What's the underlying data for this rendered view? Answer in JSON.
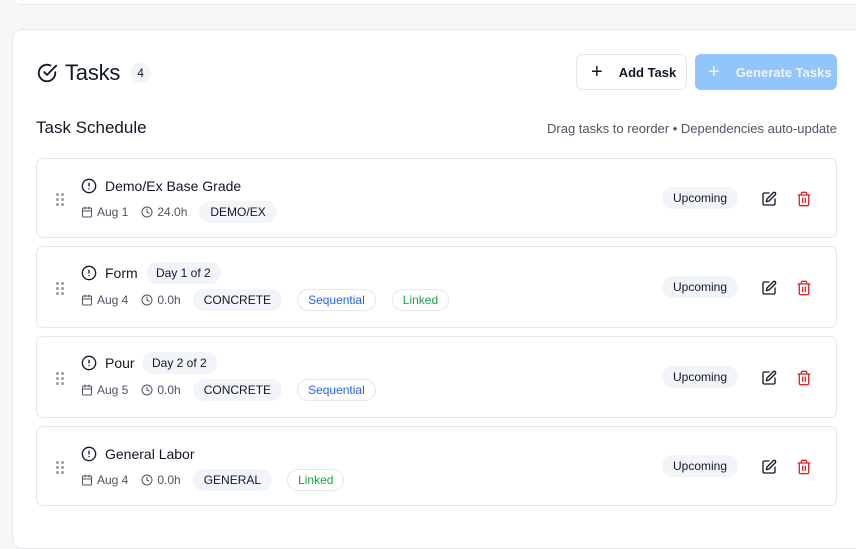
{
  "header": {
    "title": "Tasks",
    "count": "4",
    "add_label": "Add Task",
    "generate_label": "Generate Tasks"
  },
  "schedule": {
    "title": "Task Schedule",
    "hint": "Drag tasks to reorder • Dependencies auto-update"
  },
  "colors": {
    "accent_disabled": "#93c5fd",
    "danger": "#dc2626",
    "sequential": "#2563eb",
    "linked": "#16a34a"
  },
  "tasks": [
    {
      "name": "Demo/Ex Base Grade",
      "day": "",
      "date": "Aug 1",
      "hours": "24.0h",
      "tag": "DEMO/EX",
      "pills": [],
      "status": "Upcoming"
    },
    {
      "name": "Form",
      "day": "Day 1 of 2",
      "date": "Aug 4",
      "hours": "0.0h",
      "tag": "CONCRETE",
      "pills": [
        "Sequential",
        "Linked"
      ],
      "status": "Upcoming"
    },
    {
      "name": "Pour",
      "day": "Day 2 of 2",
      "date": "Aug 5",
      "hours": "0.0h",
      "tag": "CONCRETE",
      "pills": [
        "Sequential"
      ],
      "status": "Upcoming"
    },
    {
      "name": "General Labor",
      "day": "",
      "date": "Aug 4",
      "hours": "0.0h",
      "tag": "GENERAL",
      "pills": [
        "Linked"
      ],
      "status": "Upcoming"
    }
  ]
}
